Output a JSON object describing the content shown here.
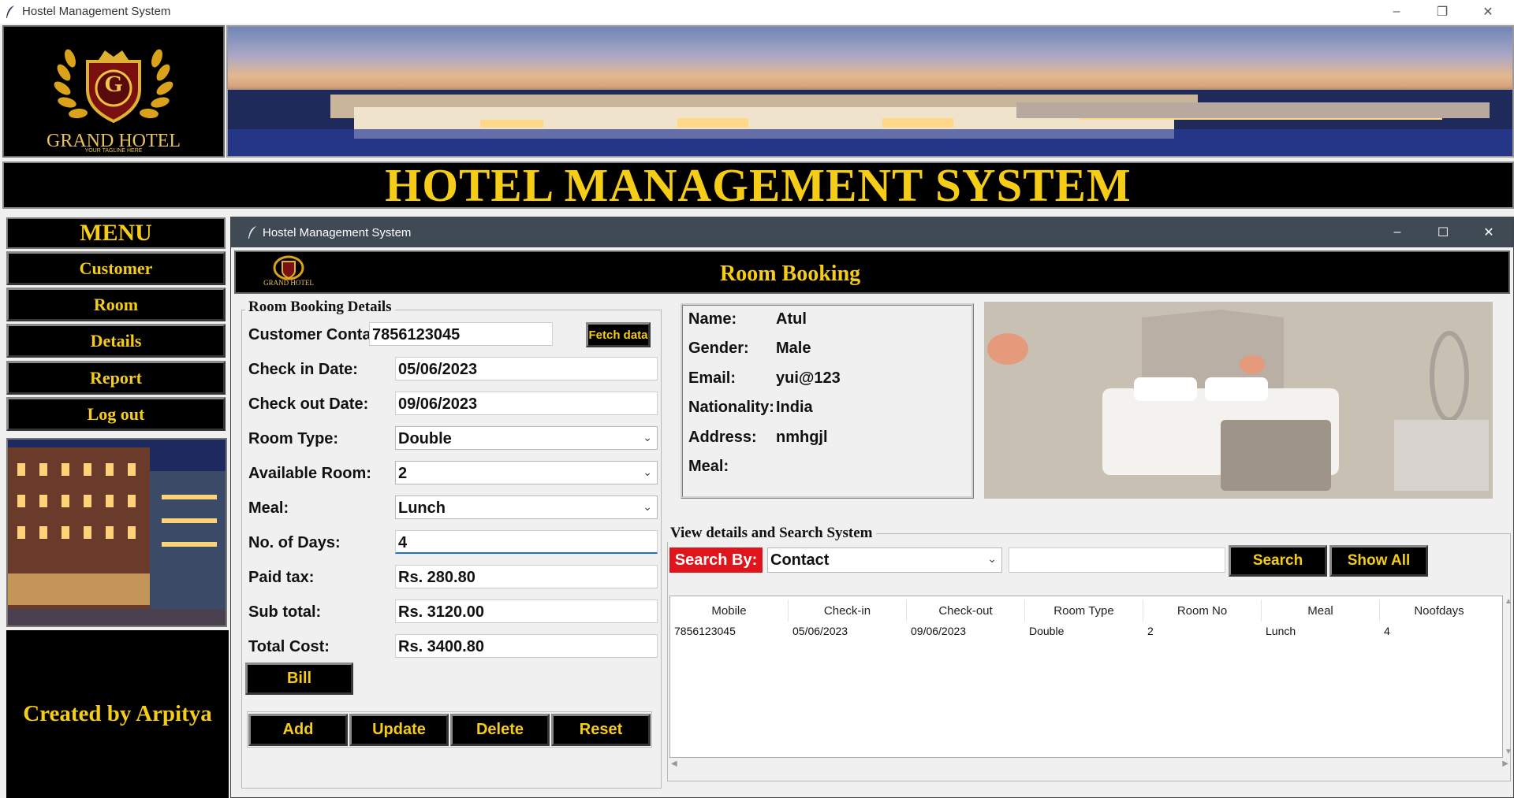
{
  "outer_window": {
    "title": "Hostel Management System"
  },
  "header": {
    "logo_name": "GRAND HOTEL",
    "logo_letter": "G",
    "logo_tagline": "YOUR TAGLINE HERE",
    "system_title": "HOTEL MANAGEMENT SYSTEM"
  },
  "sidebar": {
    "menu_title": "MENU",
    "items": [
      {
        "label": "Customer"
      },
      {
        "label": "Room"
      },
      {
        "label": "Details"
      },
      {
        "label": "Report"
      },
      {
        "label": "Log out"
      }
    ],
    "credit": "Created by Arpitya"
  },
  "child_window": {
    "title": "Hostel Management System",
    "page_title": "Room Booking",
    "logo_name": "GRAND HOTEL"
  },
  "booking_form": {
    "group_title": "Room Booking Details",
    "customer_contact": {
      "label": "Customer Contact:",
      "value": "7856123045"
    },
    "fetch_button": "Fetch data",
    "check_in": {
      "label": "Check in Date:",
      "value": "05/06/2023"
    },
    "check_out": {
      "label": "Check out Date:",
      "value": "09/06/2023"
    },
    "room_type": {
      "label": "Room Type:",
      "value": "Double"
    },
    "available_room": {
      "label": "Available Room:",
      "value": "2"
    },
    "meal": {
      "label": "Meal:",
      "value": "Lunch"
    },
    "days": {
      "label": "No. of Days:",
      "value": "4"
    },
    "paid_tax": {
      "label": "Paid tax:",
      "value": "Rs. 280.80"
    },
    "sub_total": {
      "label": "Sub total:",
      "value": "Rs. 3120.00"
    },
    "total_cost": {
      "label": "Total Cost:",
      "value": "Rs. 3400.80"
    },
    "bill_button": "Bill",
    "actions": {
      "add": "Add",
      "update": "Update",
      "delete": "Delete",
      "reset": "Reset"
    }
  },
  "customer_info": {
    "rows": [
      {
        "label": "Name:",
        "value": "Atul"
      },
      {
        "label": "Gender:",
        "value": "Male"
      },
      {
        "label": "Email:",
        "value": "yui@123"
      },
      {
        "label": "Nationality:",
        "value": "India"
      },
      {
        "label": "Address:",
        "value": "nmhgjl"
      },
      {
        "label": "Meal:",
        "value": ""
      }
    ]
  },
  "search": {
    "group_title": "View details and Search System",
    "label": "Search By:",
    "by_value": "Contact",
    "text_value": "",
    "search_button": "Search",
    "show_all_button": "Show All"
  },
  "table": {
    "columns": [
      "Mobile",
      "Check-in",
      "Check-out",
      "Room Type",
      "Room No",
      "Meal",
      "Noofdays"
    ],
    "rows": [
      [
        "7856123045",
        "05/06/2023",
        "09/06/2023",
        "Double",
        "2",
        "Lunch",
        "4"
      ]
    ]
  },
  "colors": {
    "accent_yellow": "#f5cc16",
    "search_red": "#e0141b",
    "titlebar_dark": "#404a54"
  }
}
